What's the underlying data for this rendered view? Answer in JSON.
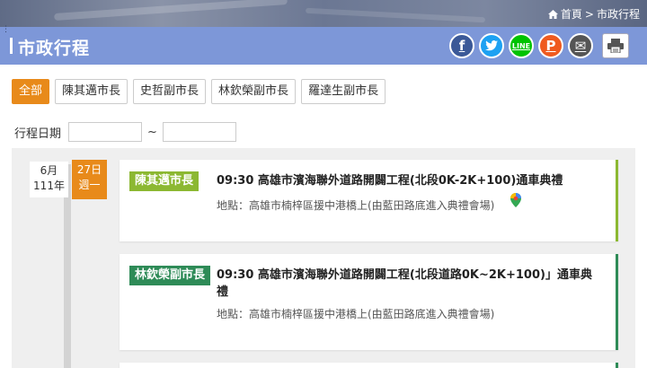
{
  "breadcrumb": {
    "home": "首頁",
    "separator": ">",
    "current": "市政行程"
  },
  "page_title": "市政行程",
  "share": {
    "facebook": "f",
    "twitter": "t",
    "line": "LINE",
    "plurk": "P",
    "mail": "✉",
    "print": "🖶"
  },
  "filters": [
    "全部",
    "陳其邁市長",
    "史哲副市長",
    "林欽榮副市長",
    "羅達生副市長"
  ],
  "date_filter": {
    "label": "行程日期",
    "separator": "~",
    "start_value": "",
    "end_value": ""
  },
  "date": {
    "month": "6月",
    "year": "111年",
    "day": "27日",
    "weekday": "週一"
  },
  "events": [
    {
      "tag": "陳其邁市長",
      "title": "09:30 高雄市濱海聯外道路開闢工程(北段0K-2K+100)通車典禮",
      "location": "地點：高雄市楠梓區援中港橋上(由藍田路底進入典禮會場)"
    },
    {
      "tag": "林欽榮副市長",
      "title": "09:30 高雄市濱海聯外道路開闢工程(北段道路0K~2K+100)」通車典禮",
      "location": "地點：高雄市楠梓區援中港橋上(由藍田路底進入典禮會場)"
    }
  ],
  "colors": {
    "accent": "#e88a1a",
    "title_bar": "#7d97d8",
    "mayor_tag": "#8cb832",
    "deputy_tag": "#2e8b57"
  }
}
